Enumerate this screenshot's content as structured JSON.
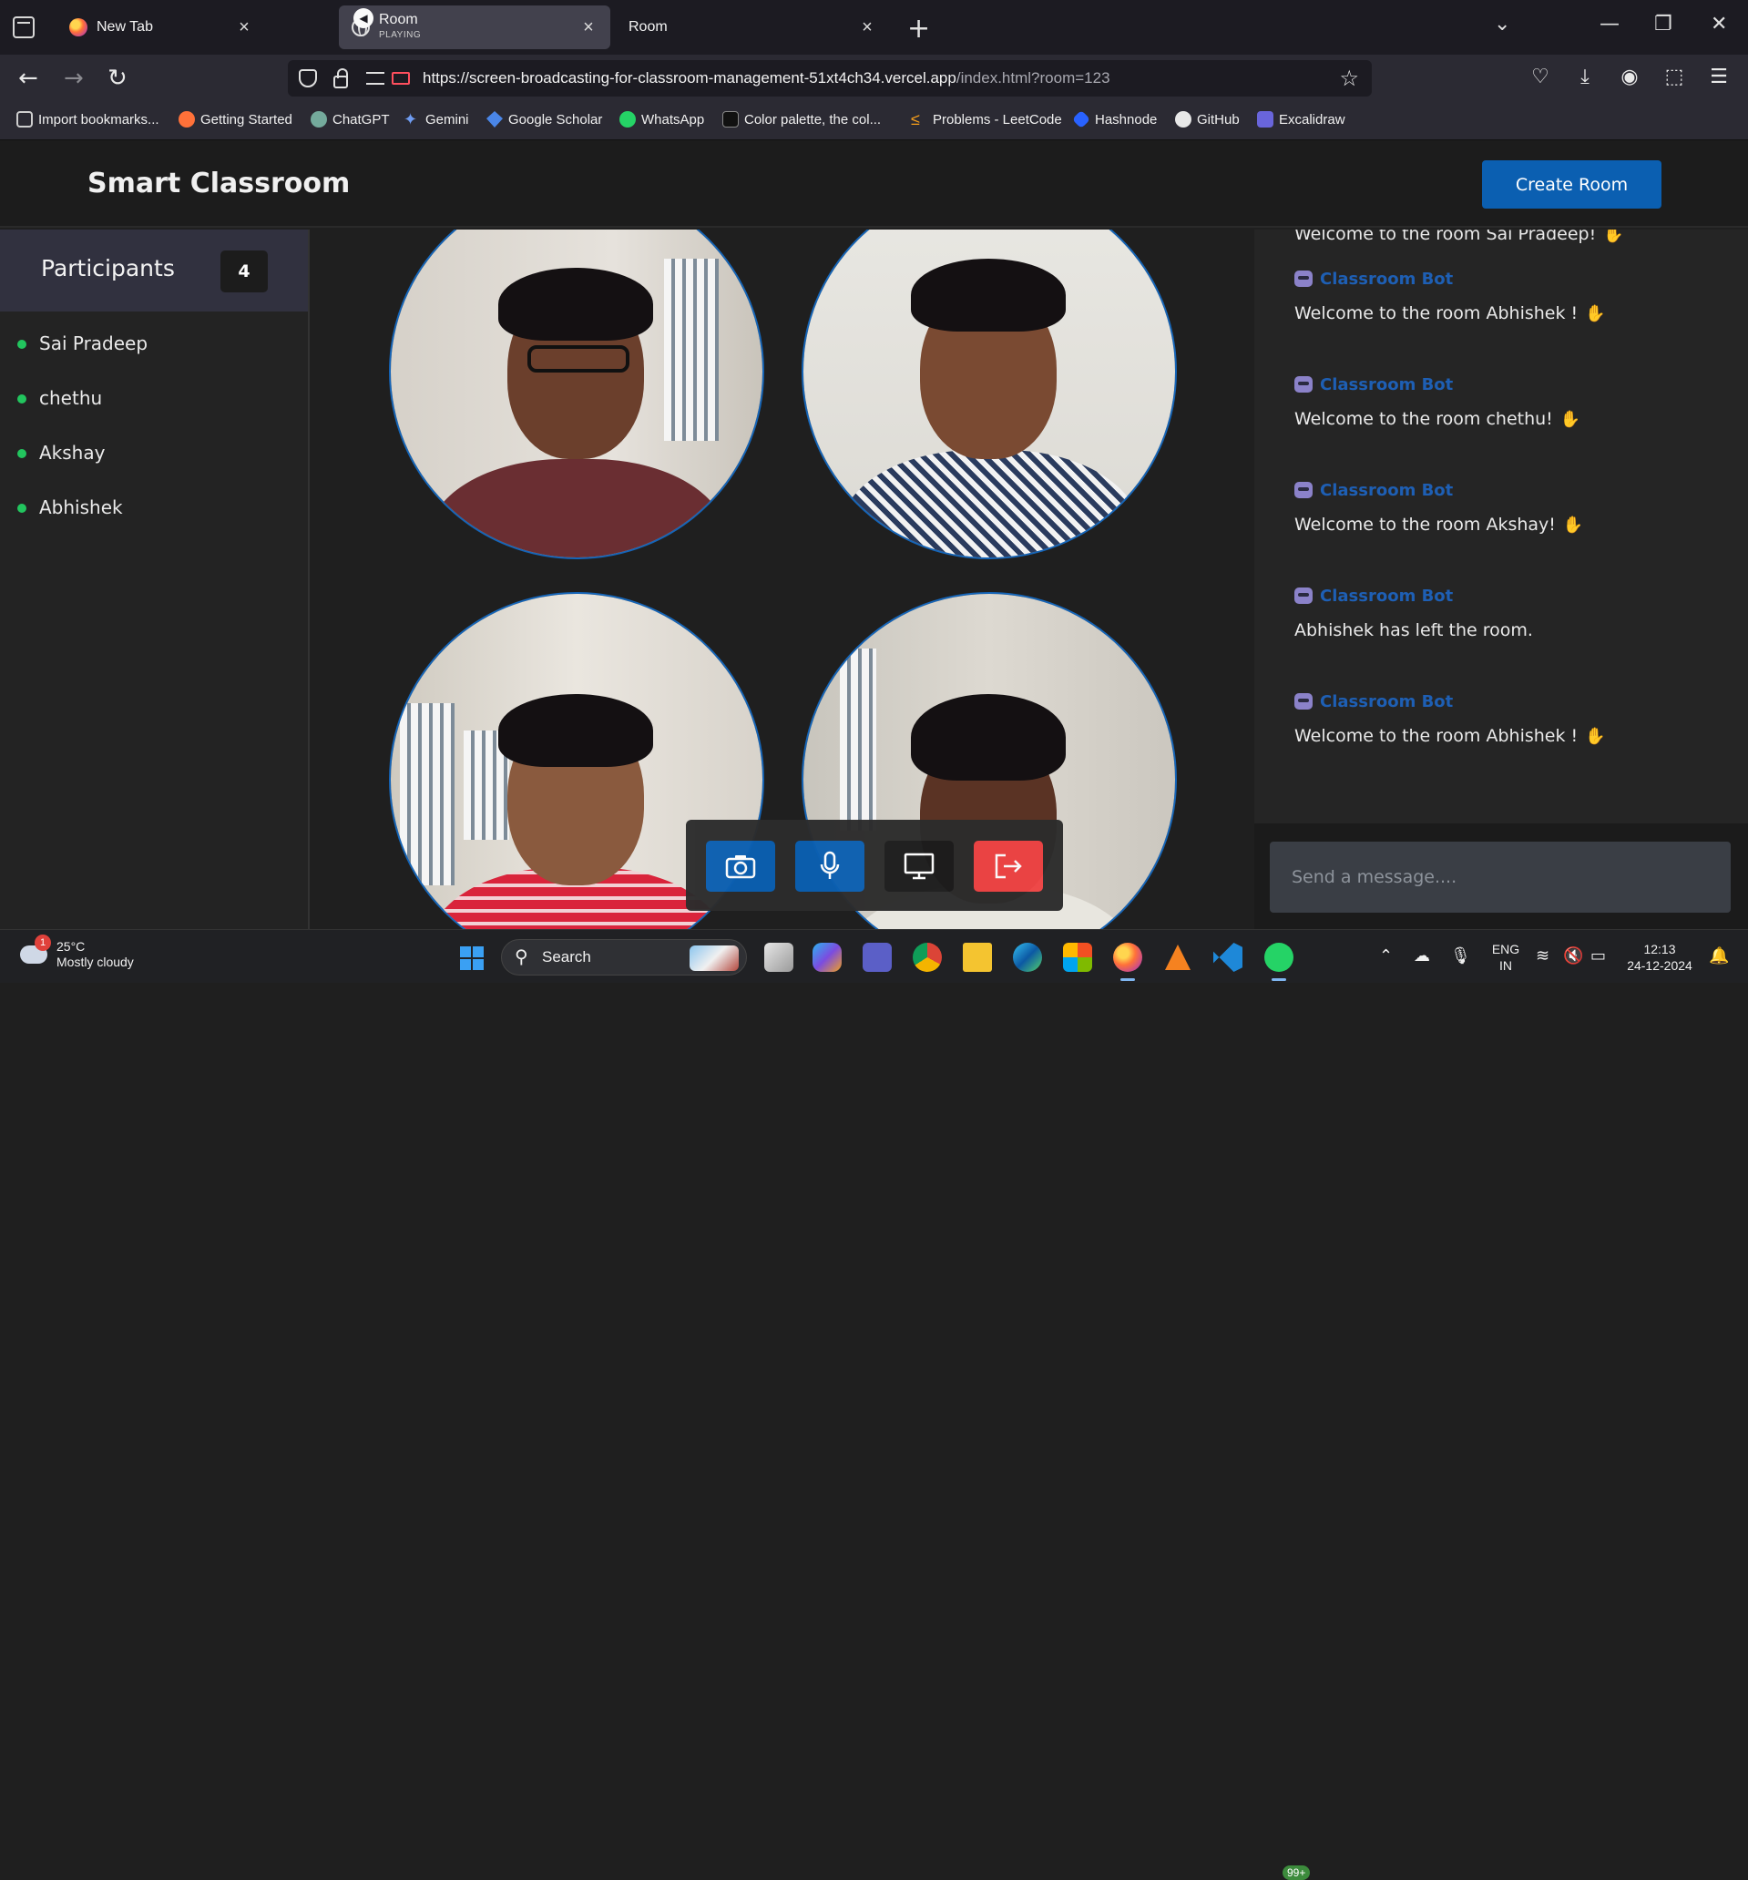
{
  "browser": {
    "tabs": [
      {
        "title": "New Tab",
        "subtitle": "",
        "active": false
      },
      {
        "title": "Room",
        "subtitle": "PLAYING",
        "active": true
      },
      {
        "title": "Room",
        "subtitle": "",
        "active": false
      }
    ],
    "url_main": "https://screen-broadcasting-for-classroom-management-51xt4ch34.vercel.app",
    "url_path": "/index.html?room=123",
    "bookmarks": [
      {
        "label": "Import bookmarks...",
        "color": "#cfcfcf"
      },
      {
        "label": "Getting Started",
        "color": "#ff7139"
      },
      {
        "label": "ChatGPT",
        "color": "#74aa9c"
      },
      {
        "label": "Gemini",
        "color": "#6f9cf2"
      },
      {
        "label": "Google Scholar",
        "color": "#4a86e8"
      },
      {
        "label": "WhatsApp",
        "color": "#25d366"
      },
      {
        "label": "Color palette, the col...",
        "color": "#111111"
      },
      {
        "label": "Problems - LeetCode",
        "color": "#f89f1b"
      },
      {
        "label": "Hashnode",
        "color": "#2962ff"
      },
      {
        "label": "GitHub",
        "color": "#e8e8e8"
      },
      {
        "label": "Excalidraw",
        "color": "#6965db"
      }
    ]
  },
  "app": {
    "brand": "Smart Classroom",
    "create_room_label": "Create Room",
    "participants_title": "Participants",
    "participants_count": "4",
    "participants": [
      "Sai Pradeep",
      "chethu",
      "Akshay",
      "Abhishek"
    ],
    "chat": {
      "partial_top": "Welcome to the room Sai Pradeep!",
      "bot_name": "Classroom Bot",
      "messages": [
        {
          "text": "Welcome to the room Abhishek !",
          "wave": true
        },
        {
          "text": "Welcome to the room chethu!",
          "wave": true
        },
        {
          "text": "Welcome to the room Akshay!",
          "wave": true
        },
        {
          "text": "Abhishek has left the room.",
          "wave": false
        },
        {
          "text": "Welcome to the room Abhishek !",
          "wave": true
        }
      ],
      "input_placeholder": "Send a message...."
    },
    "controls": {
      "camera_color": "#0b5fb1",
      "mic_color": "#0b5fb1",
      "screen_color": "#1c1c1c",
      "leave_color": "#ef4444"
    },
    "accent": "#0b5fb1"
  },
  "taskbar": {
    "temperature": "25°C",
    "weather": "Mostly cloudy",
    "weather_badge": "1",
    "search_label": "Search",
    "whatsapp_badge": "99+",
    "lang_top": "ENG",
    "lang_bottom": "IN",
    "time": "12:13",
    "date": "24-12-2024"
  }
}
